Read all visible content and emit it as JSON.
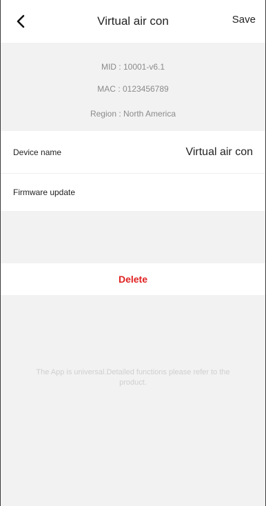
{
  "header": {
    "title": "Virtual air con",
    "save_label": "Save",
    "back_icon": "chevron-left-icon"
  },
  "info": {
    "mid": "MID : 10001-v6.1",
    "mac": "MAC : 0123456789",
    "region": "Region : North America"
  },
  "settings": {
    "device_name_label": "Device name",
    "device_name_value": "Virtual air con",
    "firmware_label": "Firmware update"
  },
  "actions": {
    "delete_label": "Delete",
    "delete_color": "#e02020"
  },
  "footer": {
    "note": "The App is universal.Detailed functions please refer to the product."
  }
}
